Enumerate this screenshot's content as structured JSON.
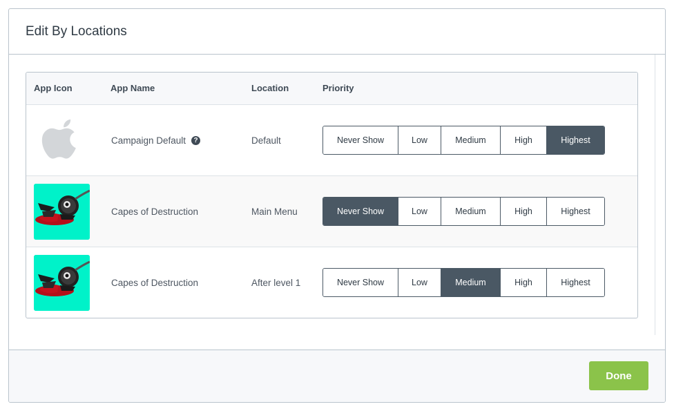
{
  "modal": {
    "title": "Edit By Locations",
    "done_label": "Done"
  },
  "table": {
    "headers": {
      "icon": "App Icon",
      "name": "App Name",
      "location": "Location",
      "priority": "Priority"
    },
    "priority_options": [
      "Never Show",
      "Low",
      "Medium",
      "High",
      "Highest"
    ],
    "rows": [
      {
        "icon": "apple-logo-icon",
        "name": "Campaign Default",
        "has_help": true,
        "location": "Default",
        "selected_priority": "Highest"
      },
      {
        "icon": "capes-of-destruction-app-icon",
        "name": "Capes of Destruction",
        "has_help": false,
        "location": "Main Menu",
        "selected_priority": "Never Show"
      },
      {
        "icon": "capes-of-destruction-app-icon",
        "name": "Capes of Destruction",
        "has_help": false,
        "location": "After level 1",
        "selected_priority": "Medium"
      }
    ]
  },
  "colors": {
    "accent_dark": "#4a5864",
    "done_green": "#8bc34a",
    "app_icon_bg": "#00f2c9"
  }
}
